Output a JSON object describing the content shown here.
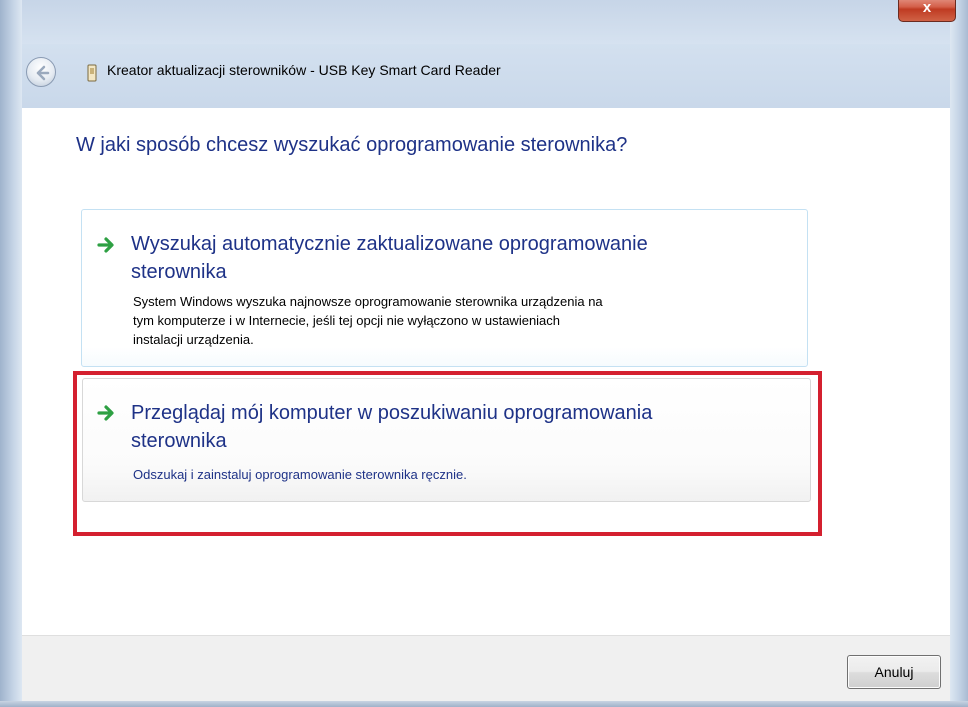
{
  "window": {
    "title": "Kreator aktualizacji sterowników - USB Key Smart Card Reader",
    "close_label": "x",
    "icons": {
      "back": "back-arrow-icon",
      "app": "device-icon",
      "close": "close-icon"
    }
  },
  "main": {
    "heading": "W jaki sposób chcesz wyszukać oprogramowanie sterownika?",
    "options": [
      {
        "title_line1": "Wyszukaj automatycznie zaktualizowane oprogramowanie",
        "title_line2": "sterownika",
        "description_lines": [
          "System Windows wyszuka najnowsze oprogramowanie sterownika urządzenia na",
          "tym komputerze i w Internecie, jeśli tej opcji nie wyłączono w ustawieniach",
          "instalacji urządzenia."
        ],
        "icon": "green-arrow-icon"
      },
      {
        "title_line1": "Przeglądaj mój komputer w poszukiwaniu oprogramowania",
        "title_line2": "sterownika",
        "description_lines": [
          "Odszukaj i zainstaluj oprogramowanie sterownika ręcznie."
        ],
        "icon": "green-arrow-icon",
        "highlighted": true
      }
    ]
  },
  "footer": {
    "cancel_label": "Anuluj"
  },
  "colors": {
    "heading": "#1e3287",
    "highlight": "#d4202f",
    "arrow": "#2ea043"
  }
}
